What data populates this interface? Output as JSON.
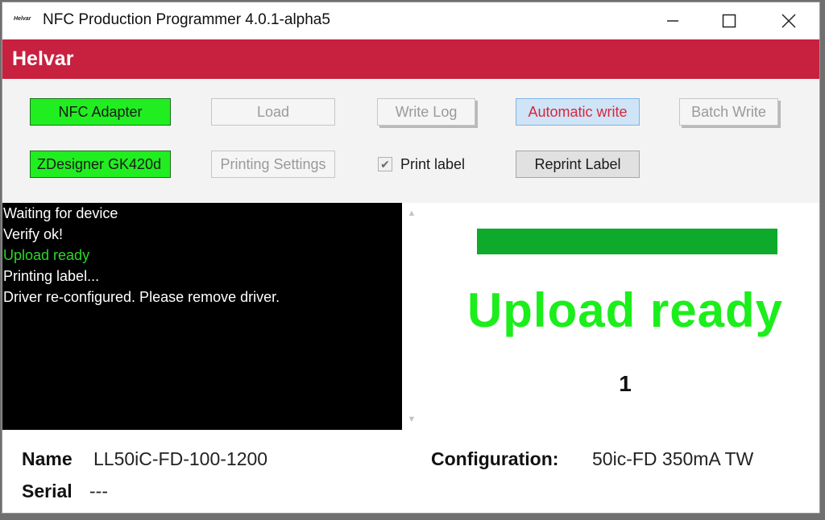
{
  "window": {
    "title": "NFC Production Programmer 4.0.1-alpha5",
    "app_icon_text": "Helvar"
  },
  "brand": {
    "name": "Helvar",
    "color": "#c8203f"
  },
  "toolbar": {
    "nfc_adapter": "NFC Adapter",
    "load": "Load",
    "write_log": "Write Log",
    "automatic_write": "Automatic write",
    "batch_write": "Batch Write",
    "printer": "ZDesigner GK420d",
    "printing_settings": "Printing Settings",
    "print_label": "Print label",
    "print_label_checked": true,
    "reprint_label": "Reprint Label"
  },
  "log": [
    {
      "text": "Waiting for device",
      "status": "normal"
    },
    {
      "text": "Verify ok!",
      "status": "normal"
    },
    {
      "text": "Upload ready",
      "status": "ok"
    },
    {
      "text": "Printing label...",
      "status": "normal"
    },
    {
      "text": "Driver re-configured. Please remove driver.",
      "status": "normal"
    }
  ],
  "status": {
    "progress_percent": 100,
    "message": "Upload ready",
    "count": "1"
  },
  "device": {
    "name_label": "Name",
    "name_value": "LL50iC-FD-100-1200",
    "serial_label": "Serial",
    "serial_value": "---",
    "configuration_label": "Configuration:",
    "configuration_value": "50ic-FD 350mA TW"
  },
  "colors": {
    "active_green": "#21ee21",
    "success_text": "#1bee1b",
    "progress_green": "#0eaa2c",
    "log_ok": "#29d829"
  }
}
